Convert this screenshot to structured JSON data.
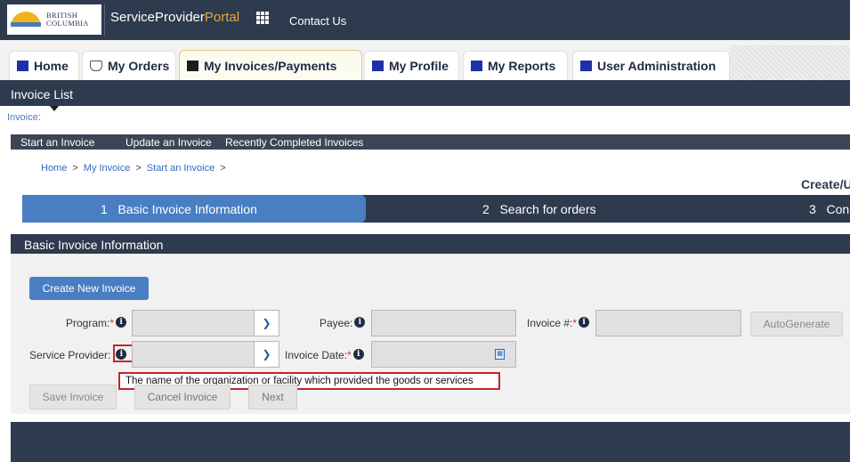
{
  "header": {
    "logo_line1": "BRITISH",
    "logo_line2": "COLUMBIA",
    "portal_main": "ServiceProvider",
    "portal_accent": "Portal",
    "contact": "Contact Us"
  },
  "tabs": [
    {
      "label": "Home",
      "icon": "square-icon"
    },
    {
      "label": "My Orders",
      "icon": "bag-icon"
    },
    {
      "label": "My Invoices/Payments",
      "icon": "square-icon",
      "active": true
    },
    {
      "label": "My Profile",
      "icon": "square-icon"
    },
    {
      "label": "My Reports",
      "icon": "square-icon"
    },
    {
      "label": "User Administration",
      "icon": "square-icon"
    }
  ],
  "page": {
    "section_title": "Invoice List",
    "invoice_label": "Invoice:",
    "subnav": [
      "Start an Invoice",
      "Update an Invoice",
      "Recently Completed Invoices"
    ],
    "breadcrumb": [
      "Home",
      "My Invoice",
      "Start an Invoice"
    ],
    "breadcrumb_sep": ">",
    "create_title": "Create/U"
  },
  "steps": [
    {
      "label": "1   Basic Invoice Information",
      "active": true
    },
    {
      "label": "2   Search for orders"
    },
    {
      "label": "3   Con"
    }
  ],
  "form": {
    "section_title": "Basic Invoice Information",
    "create_button": "Create New Invoice",
    "program_label": "Program:",
    "payee_label": "Payee:",
    "invoice_num_label": "Invoice #:",
    "autogen_button": "AutoGenerate",
    "service_provider_label": "Service Provider:",
    "invoice_date_label": "Invoice Date:",
    "required_mark": "*",
    "info_glyph": "i",
    "tooltip": "The name of the organization or facility which provided the goods or services",
    "save_button": "Save Invoice",
    "cancel_button": "Cancel Invoice",
    "next_button": "Next"
  },
  "colors": {
    "navy": "#2e3a4d",
    "step_active": "#4a7ec2",
    "highlight": "#c0272d",
    "portal_accent": "#e5a93b"
  }
}
